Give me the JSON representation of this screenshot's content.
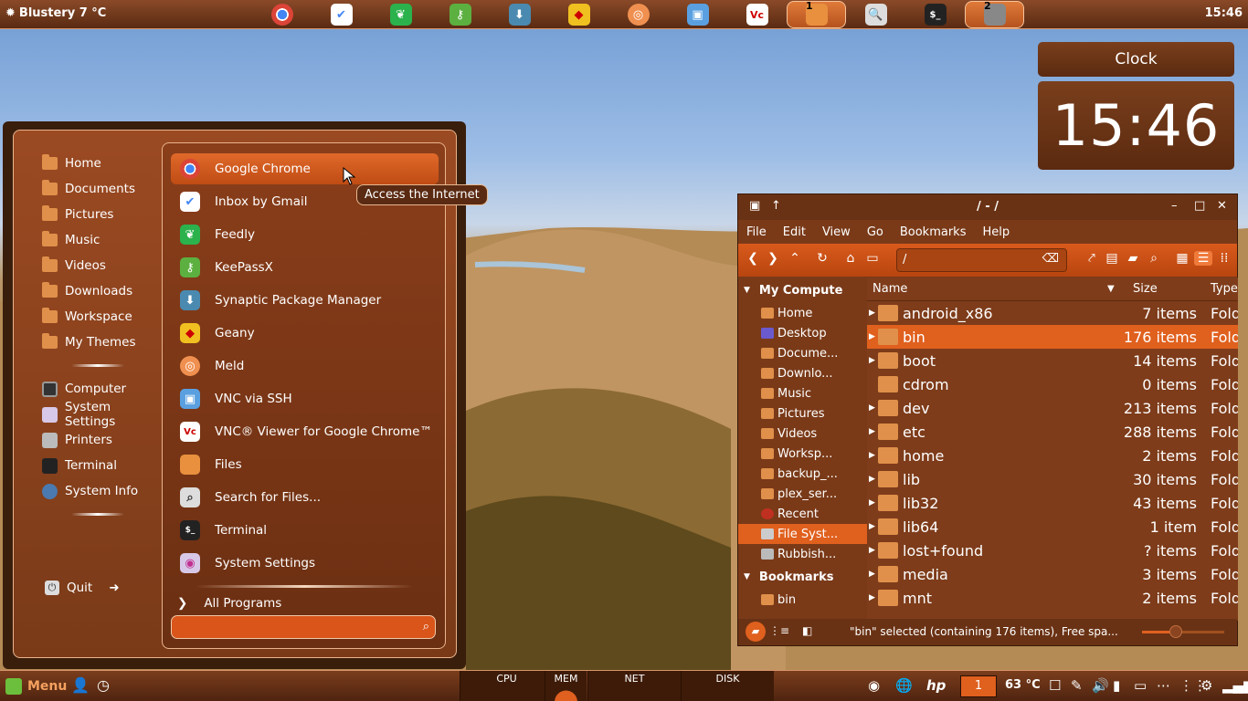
{
  "top_panel": {
    "weather": "Blustery 7 °C",
    "time": "15:46",
    "dock_numbers": [
      "1",
      "2"
    ]
  },
  "clock": {
    "title": "Clock",
    "time": "15:46"
  },
  "menu": {
    "places": [
      "Home",
      "Documents",
      "Pictures",
      "Music",
      "Videos",
      "Downloads",
      "Workspace",
      "My Themes"
    ],
    "system": [
      "Computer",
      "System Settings",
      "Printers",
      "Terminal",
      "System Info"
    ],
    "quit": "Quit",
    "apps": [
      "Google Chrome",
      "Inbox by Gmail",
      "Feedly",
      "KeePassX",
      "Synaptic Package Manager",
      "Geany",
      "Meld",
      "VNC via SSH",
      "VNC® Viewer for Google Chrome™",
      "Files",
      "Search for Files...",
      "Terminal",
      "System Settings"
    ],
    "all_programs": "All Programs",
    "tooltip": "Access the Internet"
  },
  "file_manager": {
    "title": "/ - /",
    "menubar": [
      "File",
      "Edit",
      "View",
      "Go",
      "Bookmarks",
      "Help"
    ],
    "path": "/",
    "sidebar_section": "My Compute",
    "sidebar": [
      "Home",
      "Desktop",
      "Docume...",
      "Downlo...",
      "Music",
      "Pictures",
      "Videos",
      "Worksp...",
      "backup_...",
      "plex_ser...",
      "Recent",
      "File Syst...",
      "Rubbish..."
    ],
    "bookmarks_section": "Bookmarks",
    "bookmarks": [
      "bin"
    ],
    "columns": {
      "name": "Name",
      "size": "Size",
      "type": "Type"
    },
    "rows": [
      {
        "name": "android_x86",
        "size": "7 items",
        "type": "Fold"
      },
      {
        "name": "bin",
        "size": "176 items",
        "type": "Fold"
      },
      {
        "name": "boot",
        "size": "14 items",
        "type": "Fold"
      },
      {
        "name": "cdrom",
        "size": "0 items",
        "type": "Fold"
      },
      {
        "name": "dev",
        "size": "213 items",
        "type": "Fold"
      },
      {
        "name": "etc",
        "size": "288 items",
        "type": "Fold"
      },
      {
        "name": "home",
        "size": "2 items",
        "type": "Fold"
      },
      {
        "name": "lib",
        "size": "30 items",
        "type": "Fold"
      },
      {
        "name": "lib32",
        "size": "43 items",
        "type": "Fold"
      },
      {
        "name": "lib64",
        "size": "1 item",
        "type": "Fold"
      },
      {
        "name": "lost+found",
        "size": "? items",
        "type": "Fold"
      },
      {
        "name": "media",
        "size": "3 items",
        "type": "Fold"
      },
      {
        "name": "mnt",
        "size": "2 items",
        "type": "Fold"
      }
    ],
    "status": "\"bin\" selected (containing 176 items), Free spa..."
  },
  "bottom_panel": {
    "menu_label": "Menu",
    "monitors": [
      "CPU",
      "MEM",
      "NET",
      "DISK"
    ],
    "workspace": "1",
    "temperature": "63 °C"
  },
  "colors": {
    "accent": "#e0601e",
    "panel": "#5a2a12"
  }
}
